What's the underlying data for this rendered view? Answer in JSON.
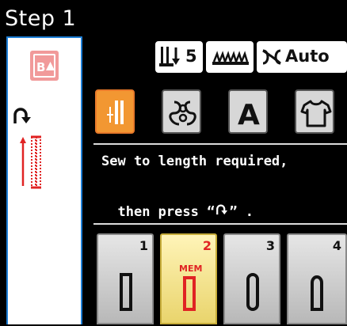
{
  "screen": {
    "title": "Step 1"
  },
  "status_bar": {
    "presser_foot_pressure": "5",
    "tension": "Auto",
    "presser_foot_icon": "presser-foot-pressure-icon",
    "feed_dog_icon": "feed-dog-icon",
    "thread_tension_icon": "thread-tension-icon"
  },
  "left_panel": {
    "memory_icon": "buttonhole-memory-icon",
    "reverse_icon": "reverse-stitch-icon",
    "preview_icon": "stitch-preview-icon"
  },
  "modes": [
    {
      "icon": "utility-stitch-icon",
      "selected": true
    },
    {
      "icon": "decorative-stitch-icon",
      "selected": false
    },
    {
      "icon": "lettering-icon",
      "label": "A",
      "selected": false
    },
    {
      "icon": "garment-icon",
      "selected": false
    }
  ],
  "instruction": {
    "line1": "Sew to length required,",
    "line2": "then press “",
    "line2_end": "” ."
  },
  "patterns": [
    {
      "number": "1",
      "selected": false
    },
    {
      "number": "2",
      "memory_label": "MEM",
      "selected": true
    },
    {
      "number": "3",
      "selected": false
    },
    {
      "number": "4",
      "selected": false
    }
  ],
  "colors": {
    "background": "#000000",
    "accent_blue": "#1e7fd6",
    "active_orange": "#f29732",
    "selected_yellow": "#f6e58a",
    "warning_red": "#e02323"
  }
}
